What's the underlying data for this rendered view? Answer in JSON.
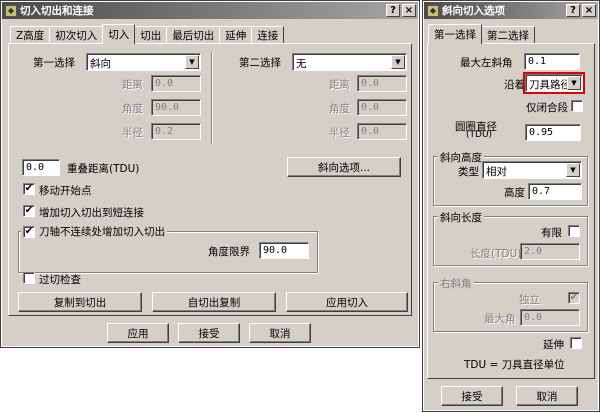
{
  "left_window": {
    "title": "切入切出和连接",
    "title_buttons": [
      "?",
      "×"
    ],
    "tabs": [
      "Z高度",
      "初次切入",
      "切入",
      "切出",
      "最后切出",
      "延伸",
      "连接"
    ],
    "active_tab": "切入",
    "first_choice": {
      "label": "第一选择",
      "value": "斜向",
      "distance_label": "距离",
      "distance": "0.0",
      "angle_label": "角度",
      "angle": "90.0",
      "radius_label": "半径",
      "radius": "0.2"
    },
    "second_choice": {
      "label": "第二选择",
      "value": "无",
      "distance_label": "距离",
      "distance": "0.0",
      "angle_label": "角度",
      "angle": "0.0",
      "radius_label": "半径",
      "radius": "0.0"
    },
    "overlap_value": "0.0",
    "overlap_label": "重叠距离(TDU)",
    "ramp_options_button": "斜向选项...",
    "move_start_label": "移动开始点",
    "add_short_link_label": "增加切入切出到短连接",
    "tool_axis_group_label": "刀轴不连续处增加切入切出",
    "angle_limit_label": "角度限界",
    "angle_limit_value": "90.0",
    "gouge_check_label": "过切检查",
    "copy_to_leadout": "复制到切出",
    "copy_from_leadout": "自切出复制",
    "apply_leadin": "应用切入",
    "apply": "应用",
    "accept": "接受",
    "cancel": "取消"
  },
  "right_window": {
    "title": "斜向切入选项",
    "title_buttons": [
      "?",
      "×"
    ],
    "tabs": [
      "第一选择",
      "第二选择"
    ],
    "active_tab": "第一选择",
    "max_left_angle_label": "最大左斜角",
    "max_left_angle": "0.1",
    "along_label": "沿着",
    "along_value": "刀具路径",
    "closed_only_label": "仅闭合段",
    "circle_diameter_label": "圆圈直径",
    "circle_diameter_unit": "(TDU)",
    "circle_diameter": "0.95",
    "ramp_height_group": "斜向高度",
    "type_label": "类型",
    "type_value": "相对",
    "height_label": "高度",
    "height_value": "0.7",
    "ramp_length_group": "斜向长度",
    "finite_label": "有限",
    "length_label": "长度(TDU)",
    "length_value": "2.0",
    "right_ramp_group": "右斜角",
    "independent_label": "独立",
    "max_angle_label": "最大角",
    "max_angle_value": "0.0",
    "extend_label": "延伸",
    "tdu_note": "TDU = 刀具直径单位",
    "accept": "接受",
    "cancel": "取消"
  },
  "colors": {
    "face": "#d4d0c8",
    "title_dark": "#4a4a4a",
    "highlight_box": "#e00000"
  }
}
